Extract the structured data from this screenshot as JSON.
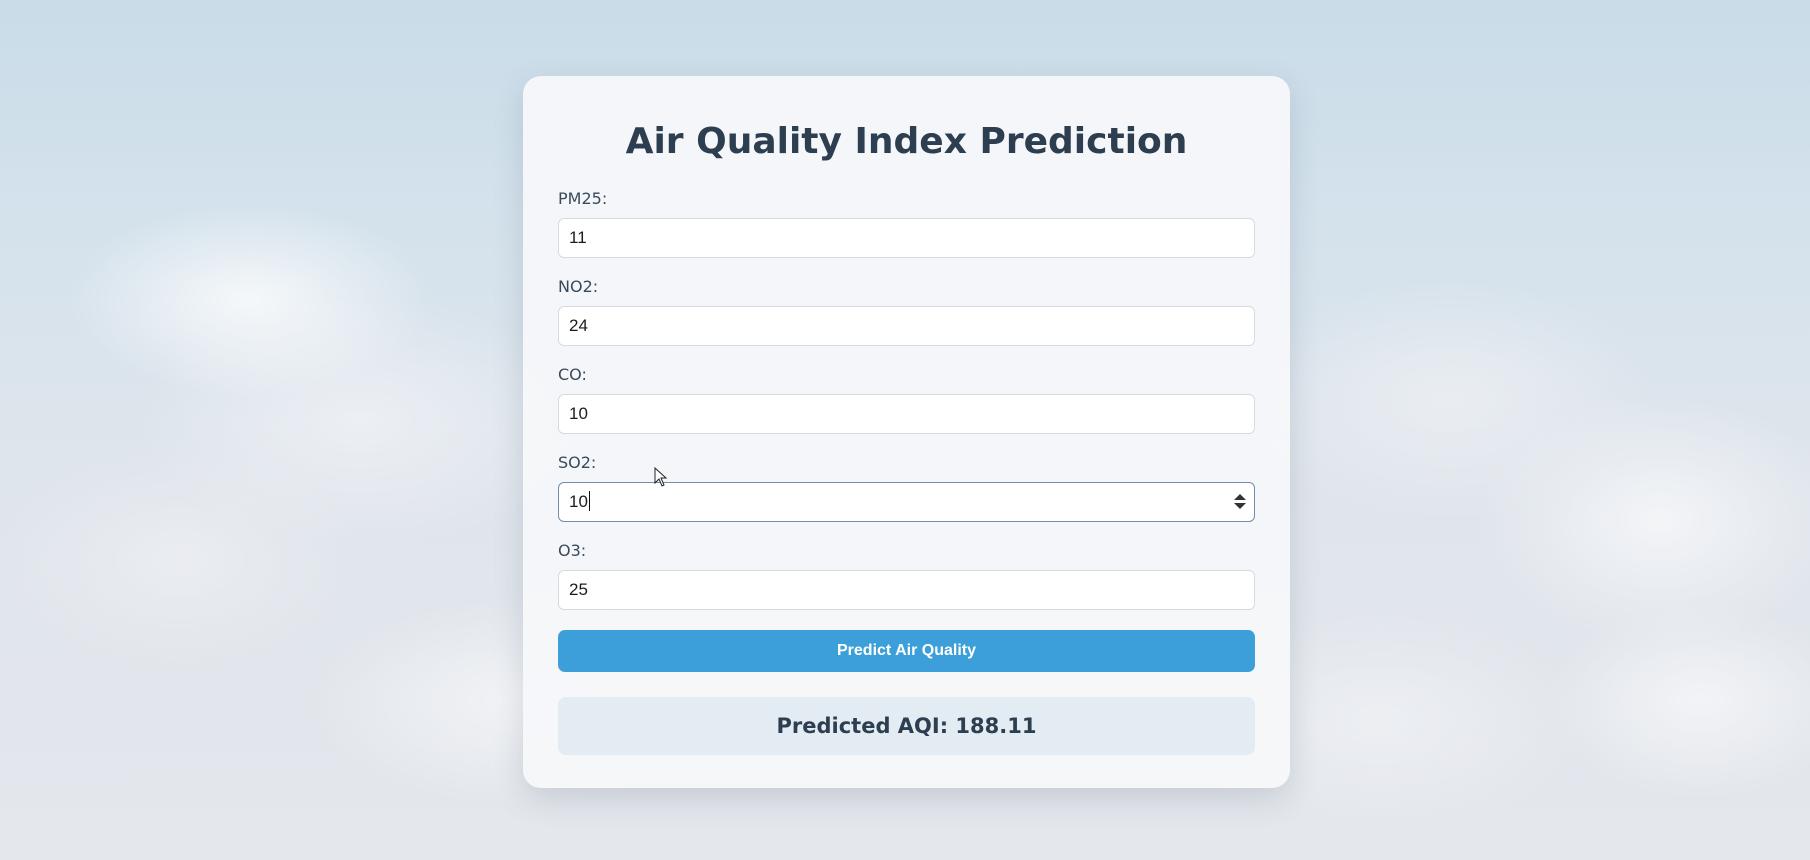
{
  "page": {
    "title": "Air Quality Index Prediction"
  },
  "form": {
    "fields": [
      {
        "label": "PM25:",
        "value": "11"
      },
      {
        "label": "NO2:",
        "value": "24"
      },
      {
        "label": "CO:",
        "value": "10"
      },
      {
        "label": "SO2:",
        "value": "10"
      },
      {
        "label": "O3:",
        "value": "25"
      }
    ],
    "submit_label": "Predict Air Quality"
  },
  "result": {
    "text": "Predicted AQI: 188.11"
  },
  "colors": {
    "button": "#3c9fd9",
    "title": "#2c3e50",
    "result_bg": "#e3ecf3"
  }
}
